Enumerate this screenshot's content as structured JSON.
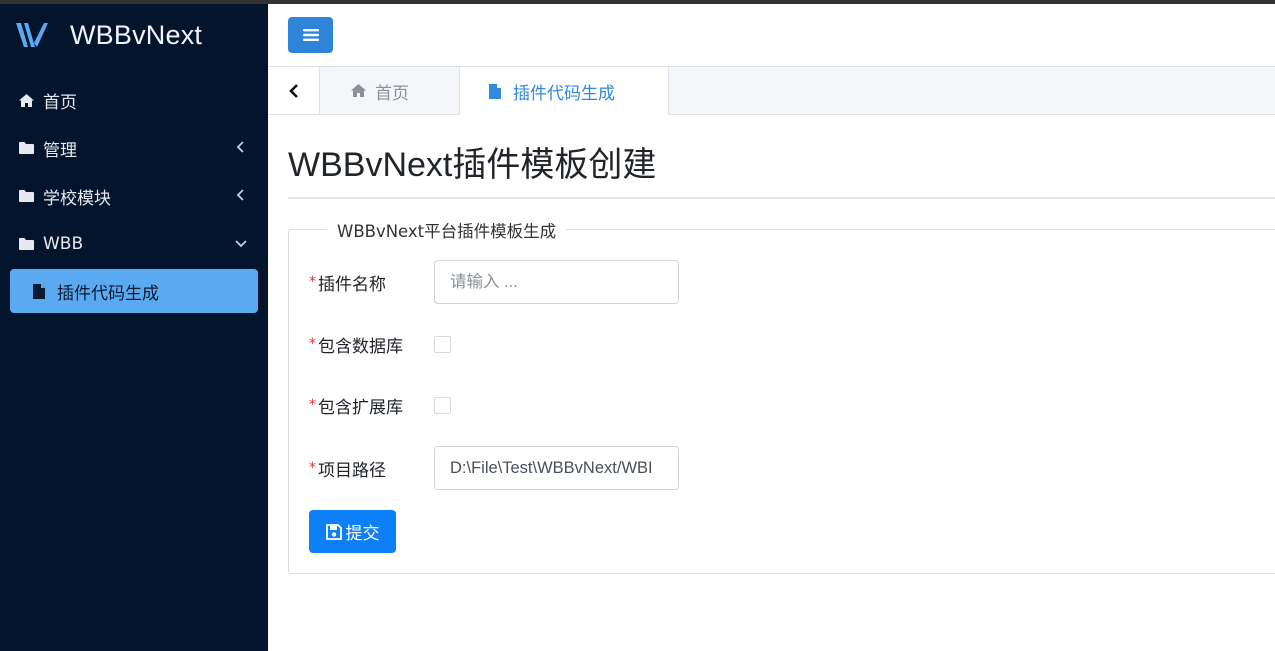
{
  "brand": {
    "name": "WBBvNext"
  },
  "sidebar": {
    "items": [
      {
        "label": "首页",
        "icon": "home-icon"
      },
      {
        "label": "管理",
        "icon": "folder-icon",
        "chevron": "chevron-left-icon"
      },
      {
        "label": "学校模块",
        "icon": "folder-icon",
        "chevron": "chevron-left-icon"
      },
      {
        "label": "WBB",
        "icon": "folder-icon",
        "chevron": "chevron-down-icon"
      }
    ],
    "active_sub": {
      "label": "插件代码生成",
      "icon": "file-icon"
    }
  },
  "tabs": [
    {
      "label": "首页",
      "icon": "home-icon"
    },
    {
      "label": "插件代码生成",
      "icon": "file-icon",
      "active": true
    }
  ],
  "page": {
    "title": "WBBvNext插件模板创建",
    "legend": "WBBvNext平台插件模板生成"
  },
  "form": {
    "required_mark": "*",
    "plugin_name": {
      "label": "插件名称",
      "placeholder": "请输入 ...",
      "value": ""
    },
    "include_db": {
      "label": "包含数据库",
      "checked": false
    },
    "include_ext": {
      "label": "包含扩展库",
      "checked": false
    },
    "project_path": {
      "label": "项目路径",
      "value": "D:\\File\\Test\\WBBvNext/WBI"
    },
    "submit_label": "提交"
  },
  "colors": {
    "sidebar_bg": "#04142c",
    "active_item": "#5aaaf2",
    "primary": "#0d7ff7",
    "menu_button": "#2e84d8",
    "tab_active_text": "#2f8ae0",
    "required": "#e03131"
  }
}
